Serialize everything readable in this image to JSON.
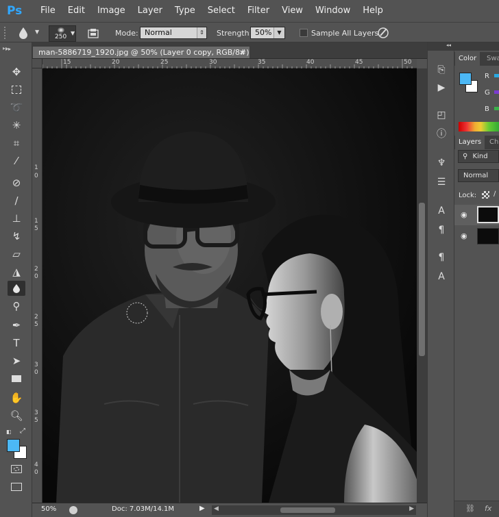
{
  "app": {
    "logo": "Ps"
  },
  "menu": [
    "File",
    "Edit",
    "Image",
    "Layer",
    "Type",
    "Select",
    "Filter",
    "View",
    "Window",
    "Help"
  ],
  "options": {
    "brush_size": "250",
    "mode_label": "Mode:",
    "mode_value": "Normal",
    "strength_label": "Strength:",
    "strength_value": "50%",
    "sample_all_layers": "Sample All Layers"
  },
  "document": {
    "tab_title": "man-5886719_1920.jpg @ 50% (Layer 0 copy, RGB/8#) *",
    "close": "×",
    "hruler_ticks": [
      "15",
      "20",
      "25",
      "30",
      "35",
      "40",
      "45",
      "50"
    ],
    "vruler_ticks": [
      "1",
      "0",
      "1",
      "5",
      "2",
      "0",
      "2",
      "5",
      "3",
      "0",
      "3",
      "5",
      "4",
      "0"
    ]
  },
  "status": {
    "zoom": "50%",
    "doc": "Doc: 7.03M/14.1M"
  },
  "panels": {
    "color_tab": "Color",
    "swatches_tab": "Swa",
    "channel_r": "R",
    "channel_g": "G",
    "channel_b": "B",
    "layers_tab": "Layers",
    "channels_tab": "Cha",
    "kind_filter": "Kind",
    "blend_mode": "Normal",
    "lock_label": "Lock:",
    "fx_label": "fx"
  },
  "colors": {
    "foreground": "#4cb8f5",
    "background": "#ffffff",
    "accent": "#31a8ff"
  }
}
